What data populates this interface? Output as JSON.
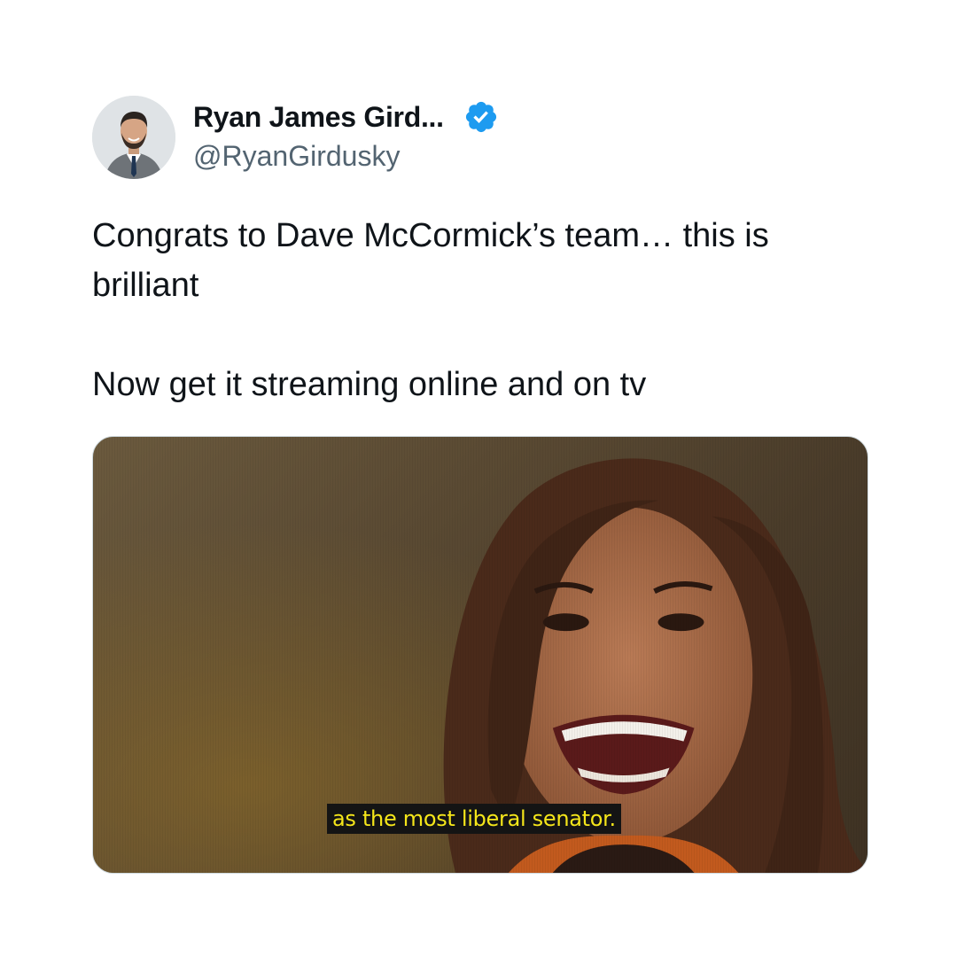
{
  "tweet": {
    "author": {
      "display_name": "Ryan James Gird...",
      "handle": "@RyanGirdusky",
      "verified_icon": "verified-badge-icon",
      "verified_color": "#1d9bf0"
    },
    "text": {
      "line1": "Congrats to Dave McCormick’s team… this is brilliant",
      "line2": "Now get it streaming online and on tv"
    },
    "media": {
      "caption": "as the most liberal senator."
    }
  }
}
